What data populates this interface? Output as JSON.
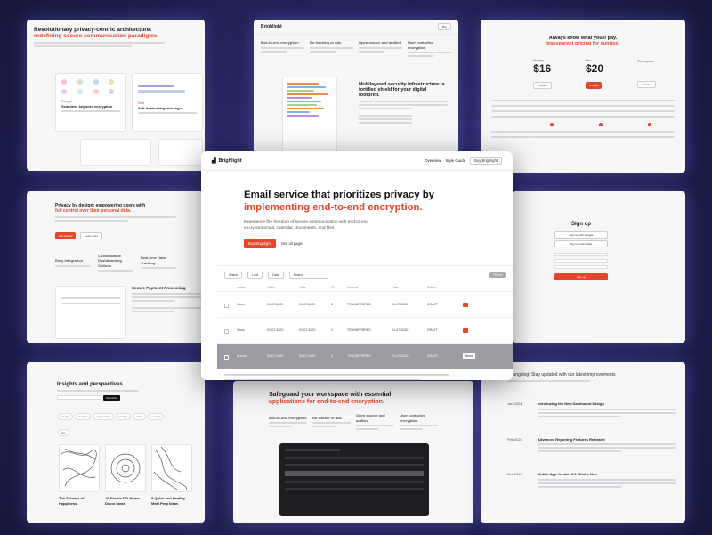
{
  "brand": "Brighlight",
  "accent": "#e5452b",
  "hero": {
    "nav": {
      "logo": "Brighlight",
      "links": [
        "Overview",
        "Style Guide"
      ],
      "cta": "Buy Brighlight"
    },
    "headline_line1": "Email service that prioritizes privacy by",
    "headline_line2": "implementing end-to-end encryption.",
    "subtext": "Experience the freedom of secure communication with end-to-end encrypted email, calendar, documents, and files.",
    "primary_cta": "Buy Brighlight",
    "secondary_cta": "See all pages",
    "table": {
      "filters": [
        "Status",
        "Last",
        "Date",
        "Email"
      ],
      "search_placeholder": "Search",
      "columns": [
        "status",
        "Client",
        "Date",
        "ID",
        "Amount",
        "Date",
        "Status"
      ],
      "rows": [
        [
          "Inbox",
          "01-07-2020",
          "01-07-2020",
          "2",
          "TRANSFERRED",
          "01-07-2020",
          "DRAFT"
        ],
        [
          "Inbox",
          "01-07-2020",
          "01-07-2020",
          "2",
          "TRANSFERRED",
          "01-07-2020",
          "DRAFT"
        ],
        [
          "Archive",
          "01-07-2020",
          "01-07-2020",
          "2",
          "TRANSFERRED",
          "01-07-2020",
          "DRAFT"
        ],
        [
          "",
          "",
          "",
          "",
          "",
          "",
          ""
        ]
      ]
    }
  },
  "cards": {
    "privacy_centric": {
      "title_line1": "Revolutionary privacy-centric architecture:",
      "title_line2": "redefining secure communication paradigms.",
      "feature1": "Seamless keyword encryption",
      "feature2": "Self-destructing messages"
    },
    "security_infra": {
      "title": "Multilayered security infrastructure: a fortified shield for your digital footprint."
    },
    "pricing": {
      "title": "Always know what you'll pay.",
      "subtitle": "transparent pricing for sunrise.",
      "price1": "$16",
      "price2": "$20",
      "plans": [
        "Hobby",
        "Pro",
        "Enterprise"
      ]
    },
    "privacy_design": {
      "title_line1": "Privacy by design: empowering users with",
      "title_line2": "full control over their personal data.",
      "features": [
        "Easy Integration",
        "Customizable Dashboarding Options",
        "Real-time Data Tracking"
      ],
      "secure_payment": "Secure Payment Processing"
    },
    "signup": {
      "title": "Sign up",
      "google": "Sign up with Google",
      "apple": "Sign up with Apple",
      "cta": "Sign up"
    },
    "insights": {
      "title": "Insights and perspectives",
      "articles": [
        "The Science of Happiness",
        "10 Simple DIY Home Decor Ideas",
        "5 Quick and Healthy Meal Prep Ideas"
      ]
    },
    "workspace": {
      "title_line1": "Safeguard your workspace with essential",
      "title_line2": "applications for end-to-end encryption."
    },
    "changelog": {
      "title": "Changelog: Stay updated with our latest improvements",
      "entries": [
        "Introducing the New Dashboard Design",
        "Advanced Reporting Features Released",
        "Mobile App Version 2.0 What's New"
      ]
    }
  }
}
